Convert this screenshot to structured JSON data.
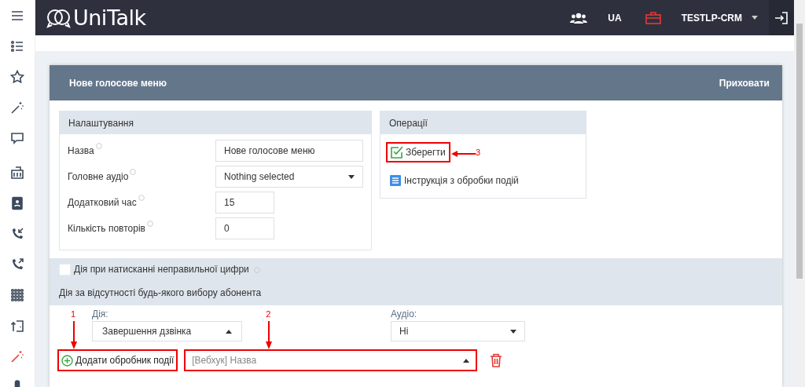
{
  "sidebar": {
    "items": [
      {
        "kind": "menu",
        "selected": false
      },
      {
        "kind": "list",
        "selected": false
      },
      {
        "kind": "star",
        "selected": false
      },
      {
        "kind": "wand",
        "selected": false
      },
      {
        "kind": "chat",
        "selected": false
      },
      {
        "kind": "building",
        "selected": false
      },
      {
        "kind": "contacts",
        "selected": false
      },
      {
        "kind": "incoming",
        "selected": false
      },
      {
        "kind": "outgoing",
        "selected": false
      },
      {
        "kind": "grid",
        "selected": false
      },
      {
        "kind": "transfer",
        "selected": false
      },
      {
        "kind": "wand",
        "selected": true
      },
      {
        "kind": "mic",
        "selected": false
      }
    ]
  },
  "topbar": {
    "logo": "UniTalk",
    "language": "UA",
    "account": "TESTLP-CRM"
  },
  "panel": {
    "title": "Нове голосове меню",
    "hide_link": "Приховати"
  },
  "settings": {
    "title": "Налаштування",
    "fields": [
      {
        "label": "Назва",
        "kind": "text",
        "value": "Нове голосове меню"
      },
      {
        "label": "Головне аудіо",
        "kind": "select",
        "value": "Nothing selected"
      },
      {
        "label": "Додатковий час",
        "kind": "number",
        "value": "15"
      },
      {
        "label": "Кількість повторів",
        "kind": "number",
        "value": "0"
      }
    ]
  },
  "operations": {
    "title": "Операції",
    "items": [
      {
        "kind": "save",
        "label": "Зберегти"
      },
      {
        "kind": "doc",
        "label": "Інструкція з обробки подій"
      }
    ]
  },
  "wrong_digit": {
    "label": "Дія при натисканні неправильної цифри",
    "checked": false
  },
  "no_choice": {
    "title": "Дія за відсутності будь-якого вибору абонента",
    "action_label": "Дія:",
    "action_value": "Завершення дзвінка",
    "action_expanded": true,
    "audio_label": "Аудіо:",
    "audio_value": "Ні",
    "audio_expanded": false,
    "add_handler": "Додати обробник події",
    "handler_value": "[Вебхук] Назва",
    "handler_expanded": true
  },
  "annotations": [
    {
      "label": "1"
    },
    {
      "label": "2"
    },
    {
      "label": "3"
    }
  ]
}
